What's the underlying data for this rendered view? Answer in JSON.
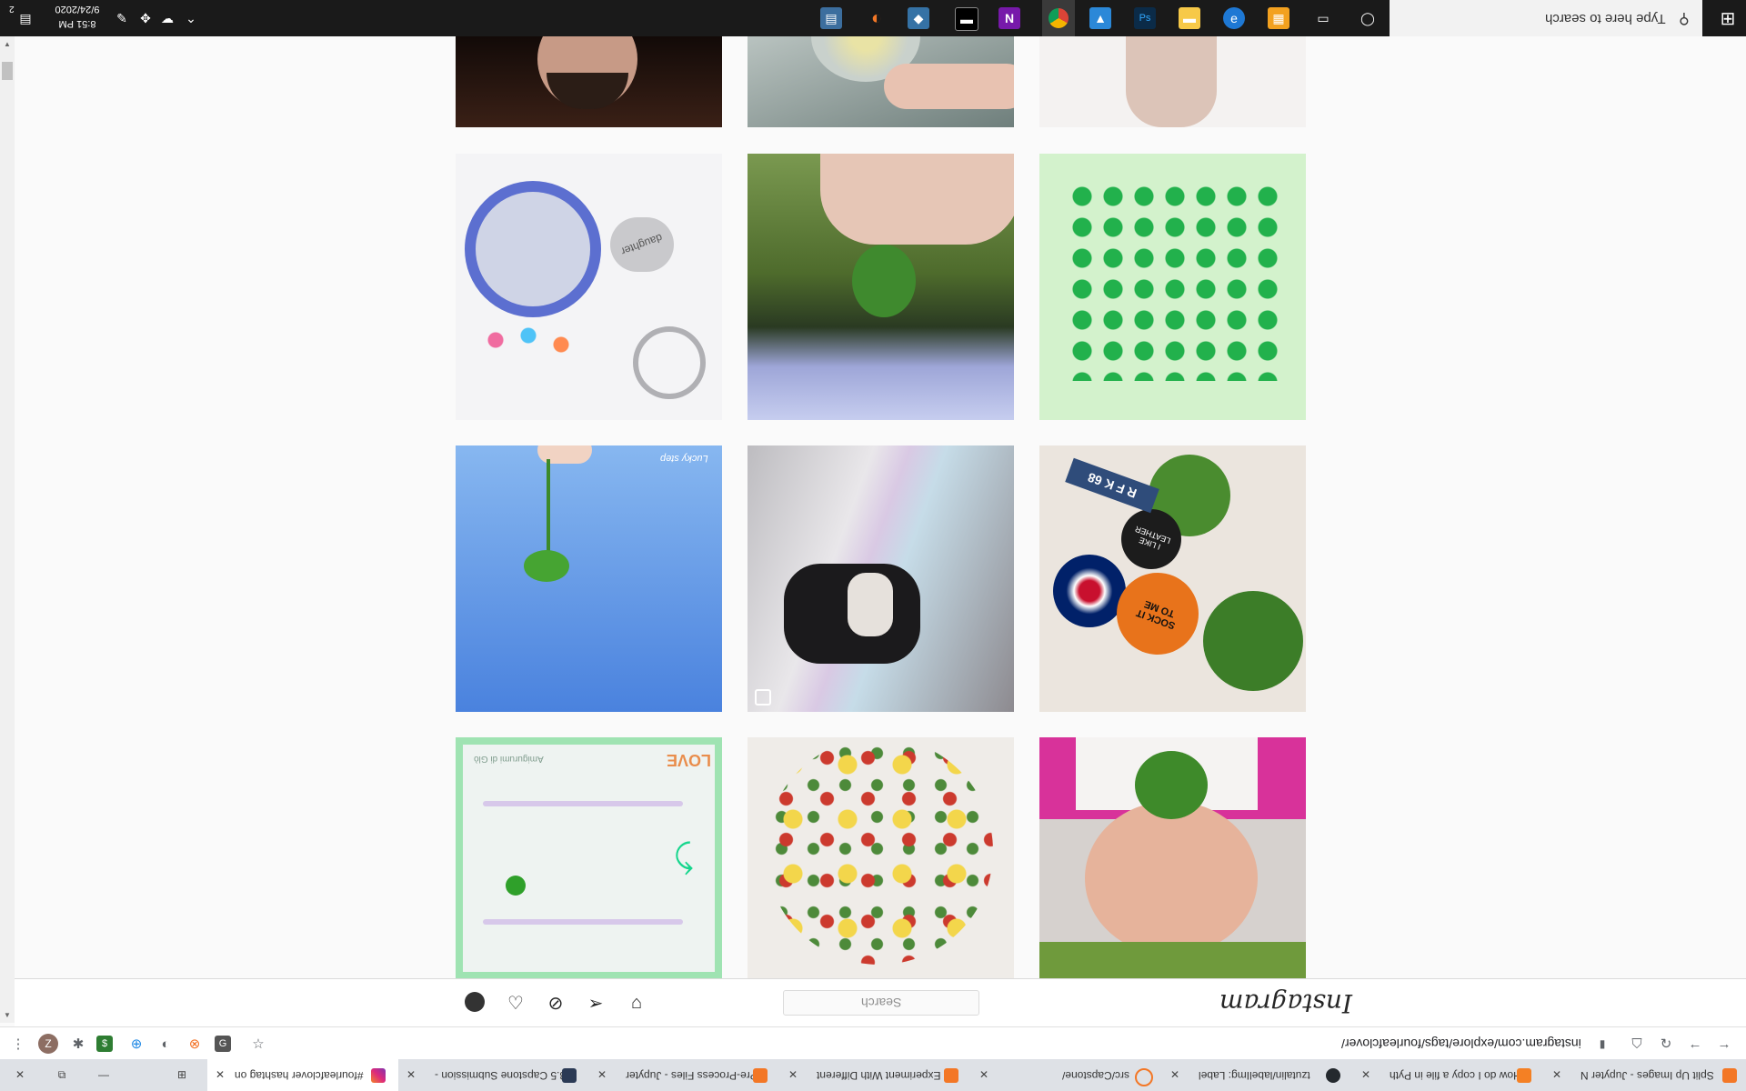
{
  "taskbar": {
    "search_placeholder": "Type here to search",
    "time": "8:51 PM",
    "date": "9/24/2020",
    "notification_count": "2",
    "apps": [
      "search-icon",
      "task-view-icon",
      "windows-store-icon",
      "edge-icon",
      "file-explorer-icon",
      "photoshop-icon",
      "photos-icon",
      "chrome-icon",
      "onenote-icon",
      "terminal-icon",
      "python-icon",
      "jupyter-icon",
      "task-manager-icon"
    ]
  },
  "instagram": {
    "logo": "Instagram",
    "search_placeholder": "Search"
  },
  "browser": {
    "url": "instagram.com/explore/tags/fourleafclover/",
    "tabs": [
      {
        "label": "#fourleafclover hashtag on",
        "active": true
      },
      {
        "label": "3.5 Capstone Submission -",
        "active": false
      },
      {
        "label": "Pre-Process Files - Jupyter",
        "active": false
      },
      {
        "label": "Experiment With Different",
        "active": false
      },
      {
        "label": "src/Capstone/",
        "active": false
      },
      {
        "label": "tzutalin/labelImg: Label",
        "active": false
      },
      {
        "label": "How do I copy a file in Pyth",
        "active": false
      },
      {
        "label": "Split Up Images - Jupyter N",
        "active": false
      }
    ]
  },
  "grid": {
    "tiles": [
      {
        "name": "post-tile-bearded-man",
        "color": "#2a1a14"
      },
      {
        "name": "post-tile-clover-in-glass",
        "color": "#9aa7a0"
      },
      {
        "name": "post-tile-arm",
        "color": "#d9c7bd"
      },
      {
        "name": "post-tile-locket",
        "color": "#f2f2f4"
      },
      {
        "name": "post-tile-hand-clover-field",
        "color": "#6d7a45"
      },
      {
        "name": "post-tile-green-clover-pattern",
        "color": "#c9efc2"
      },
      {
        "name": "post-tile-clover-blue-sky",
        "color": "#4f87e0"
      },
      {
        "name": "post-tile-dog-rainbow",
        "color": "#c7c5c8"
      },
      {
        "name": "post-tile-buttons-clovers",
        "color": "#e8e2da"
      },
      {
        "name": "post-tile-bracelets",
        "color": "#9fe3b2"
      },
      {
        "name": "post-tile-pressed-flower-pendants",
        "color": "#ece8e4"
      },
      {
        "name": "post-tile-child-clover",
        "color": "#7ea14a"
      }
    ],
    "tile_texts": {
      "buttons_sock": "SOCK IT TO ME",
      "buttons_leather": "I LIKE LEATHER",
      "buttons_plate": "R F K 68",
      "locket_charm": "daughter",
      "bracelet_text": "Amigurumi di Glò",
      "bracelet_tag": "LOVE",
      "sky_watermark": "Lucky step"
    }
  }
}
